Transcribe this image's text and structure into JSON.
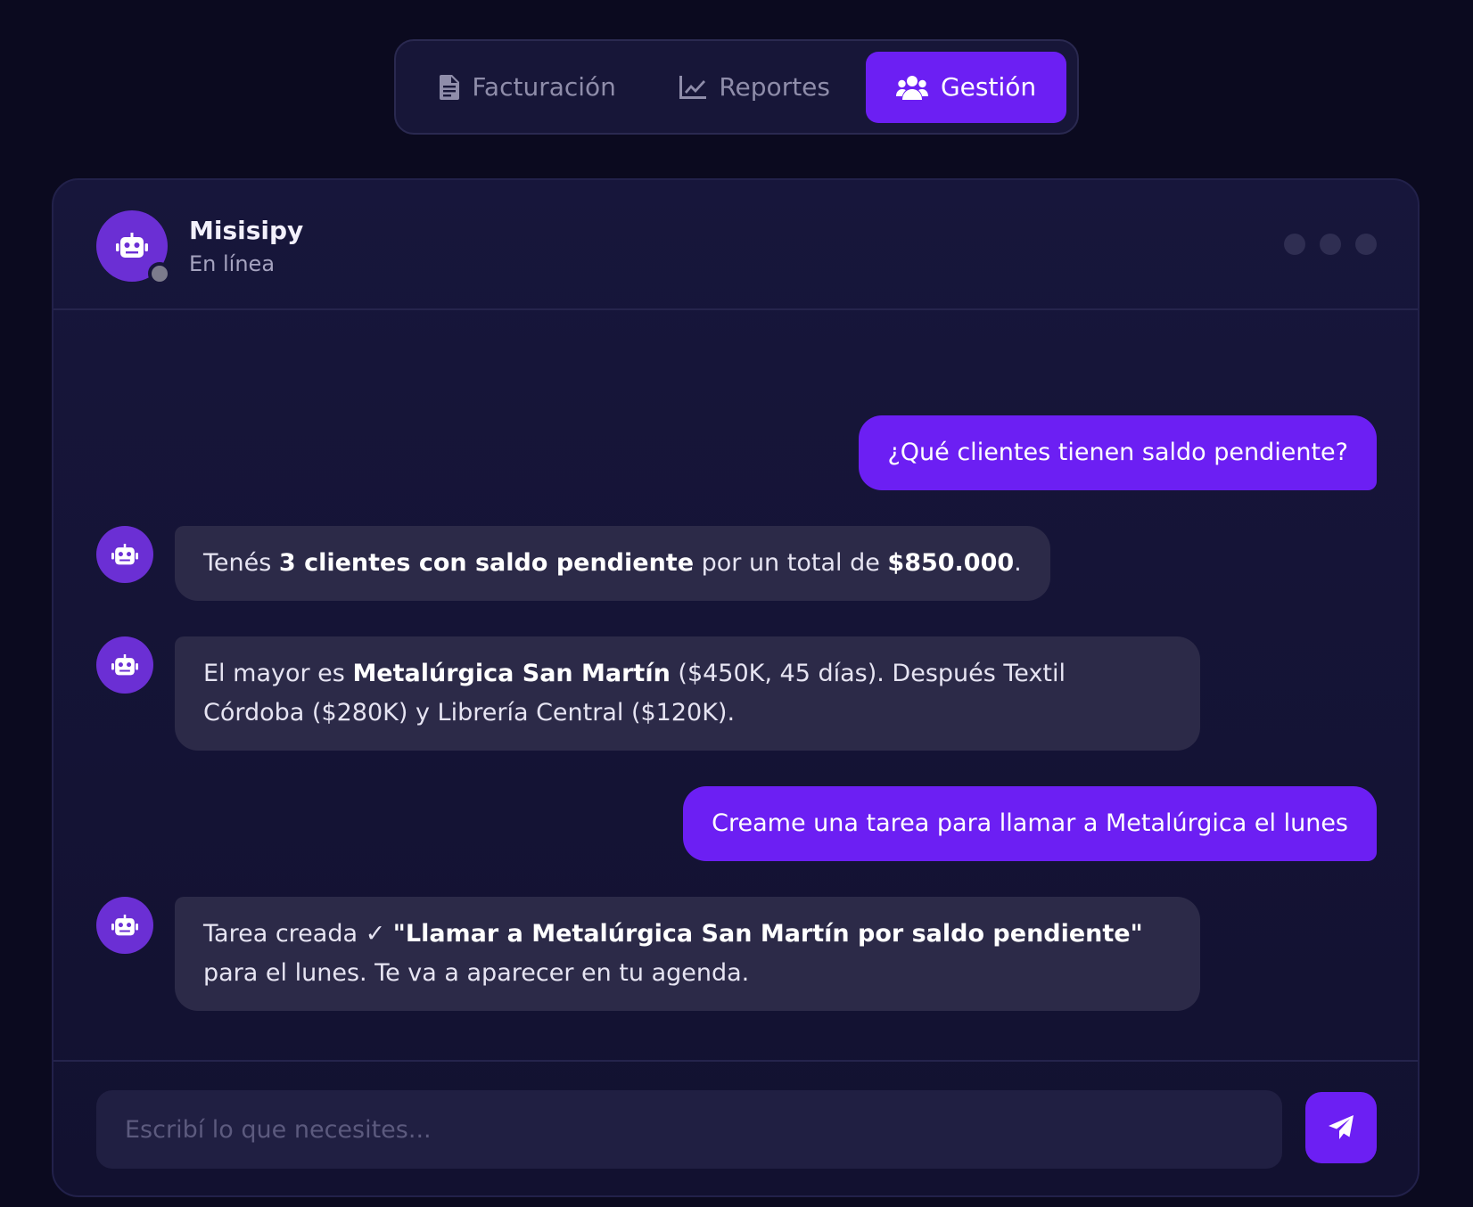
{
  "tabs": [
    {
      "label": "Facturación",
      "icon": "file-invoice-icon",
      "active": false
    },
    {
      "label": "Reportes",
      "icon": "line-chart-icon",
      "active": false
    },
    {
      "label": "Gestión",
      "icon": "users-icon",
      "active": true
    }
  ],
  "chat": {
    "bot_name": "Misisipy",
    "bot_status": "En línea"
  },
  "messages": [
    {
      "role": "user",
      "text": "¿Qué clientes tienen saldo pendiente?"
    },
    {
      "role": "bot",
      "parts": [
        "Tenés ",
        "3 clientes con saldo pendiente",
        " por un total de ",
        "$850.000",
        "."
      ]
    },
    {
      "role": "bot",
      "parts": [
        "El mayor es ",
        "Metalúrgica San Martín",
        " ($450K, 45 días). Después Textil Córdoba ($280K) y Librería Central ($120K)."
      ]
    },
    {
      "role": "user",
      "text": "Creame una tarea para llamar a Metalúrgica el lunes"
    },
    {
      "role": "bot",
      "parts": [
        "Tarea creada ✓ ",
        "\"Llamar a Metalúrgica San Martín por saldo pendiente\"",
        " para el lunes. Te va a aparecer en tu agenda."
      ]
    }
  ],
  "composer": {
    "placeholder": "Escribí lo que necesites...",
    "value": ""
  },
  "colors": {
    "accent": "#6c1ff3",
    "background": "#0b0a1f",
    "card": "#17163b",
    "bot_bubble": "#2c2a48"
  }
}
